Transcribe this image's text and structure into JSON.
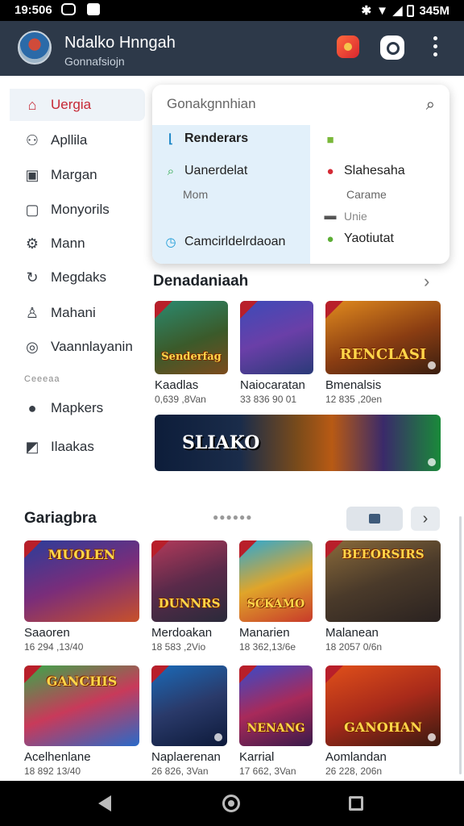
{
  "status": {
    "time": "19:506",
    "right": "345M"
  },
  "header": {
    "name": "Ndalko Hnngah",
    "subtitle": "Gonnafsiojn"
  },
  "sidebar": {
    "items": [
      {
        "label": "Uergia",
        "icon": "home-icon"
      },
      {
        "label": "Apllila",
        "icon": "people-icon"
      },
      {
        "label": "Margan",
        "icon": "calendar-icon"
      },
      {
        "label": "Monyorils",
        "icon": "info-box-icon"
      },
      {
        "label": "Mann",
        "icon": "gear-icon"
      },
      {
        "label": "Megdaks",
        "icon": "refresh-icon"
      },
      {
        "label": "Mahani",
        "icon": "person-icon"
      },
      {
        "label": "Vaannlayanin",
        "icon": "target-icon"
      }
    ],
    "section_label": "Ceeeaa",
    "extra_items": [
      {
        "label": "Mapkers",
        "icon": "compass-icon"
      },
      {
        "label": "Ilaakas",
        "icon": "chart-icon"
      }
    ]
  },
  "search": {
    "placeholder": "Gonakgnnhian",
    "left": [
      {
        "label": "Renderars",
        "icon": "corner-icon"
      },
      {
        "label": "Uanerdelat",
        "icon": "search-small-icon",
        "sub": "Mom"
      },
      {
        "label": "Camcirldelrdaoan",
        "icon": "clock-icon"
      }
    ],
    "right": [
      {
        "label": "",
        "icon": "green-square-icon"
      },
      {
        "label": "Slahesaha",
        "icon": "pin-icon",
        "sub": "Carame"
      },
      {
        "label": "",
        "icon": "folder-icon",
        "sub": "Unie"
      },
      {
        "label": "Yaotiutat",
        "icon": "leaf-icon"
      }
    ]
  },
  "featured": {
    "title": "Denadaniaah",
    "games": [
      {
        "name": "Kaadlas",
        "stat": "0,639 ,8Van",
        "art": "Senderfag"
      },
      {
        "name": "Naiocaratan",
        "stat": "33 836 90 01",
        "art": ""
      },
      {
        "name": "Bmenalsis",
        "stat": "12 835 ,20en",
        "art": "RENCLASI"
      }
    ],
    "banner": "SLIAKO"
  },
  "category": {
    "title": "Gariagbra",
    "games": [
      {
        "name": "Saaoren",
        "stat": "16 294 ,13/40",
        "art": "MUOLEN"
      },
      {
        "name": "Merdoakan",
        "stat": "18 583 ,2Vio",
        "art": "DUNNRS"
      },
      {
        "name": "Manarien",
        "stat": "18 362,13/6e",
        "art": "SCKAMO"
      },
      {
        "name": "Malanean",
        "stat": "18 2057 0/6n",
        "art": "BEEORSIRS"
      },
      {
        "name": "Acelhenlane",
        "stat": "18 892 13/40",
        "art": "GANCHIS"
      },
      {
        "name": "Naplaerenan",
        "stat": "26 826, 3Van",
        "art": ""
      },
      {
        "name": "Karrial",
        "stat": "17 662, 3Van",
        "art": "NENANG"
      },
      {
        "name": "Aomlandan",
        "stat": "26 228, 206n",
        "art": "GANOHAN"
      }
    ]
  }
}
